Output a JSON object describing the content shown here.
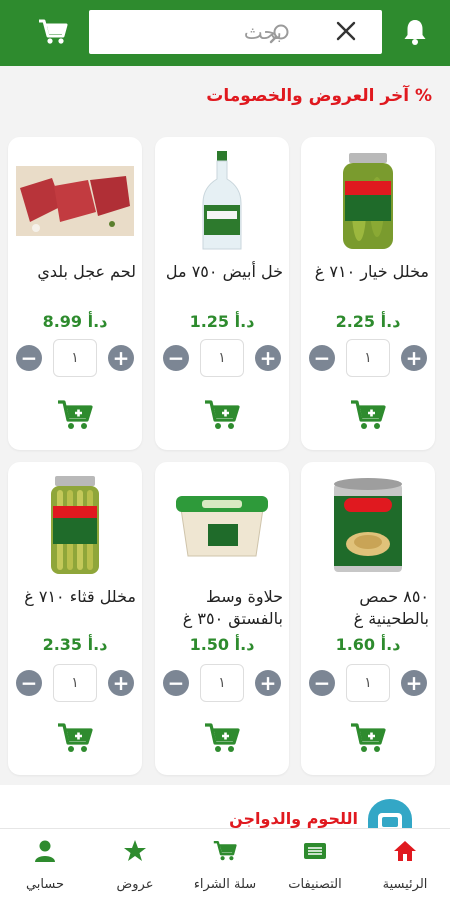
{
  "header": {
    "search_placeholder": "بحث",
    "cart_icon": "cart-icon",
    "bell_icon": "bell-icon"
  },
  "section": {
    "title": "% آخر العروض والخصومات"
  },
  "products": [
    {
      "name": "مخلل خيار ٧١٠ غ",
      "price": "2.25 د.أ",
      "qty": "١"
    },
    {
      "name": "خل أبيض ٧٥٠ مل",
      "price": "1.25 د.أ",
      "qty": "١"
    },
    {
      "name": "لحم عجل بلدي",
      "price": "8.99 د.أ",
      "qty": "١"
    },
    {
      "name": "٨٥٠ حمص بالطحينية غ",
      "price": "1.60 د.أ",
      "qty": "١"
    },
    {
      "name": "حلاوة وسط بالفستق ٣٥٠ غ",
      "price": "1.50 د.أ",
      "qty": "١"
    },
    {
      "name": "مخلل قثاء ٧١٠ غ",
      "price": "2.35 د.أ",
      "qty": "١"
    }
  ],
  "next_section": {
    "title": "اللحوم والدواجن"
  },
  "nav": [
    {
      "label": "الرئيسية",
      "icon": "home-icon"
    },
    {
      "label": "التصنيفات",
      "icon": "categories-icon"
    },
    {
      "label": "سلة الشراء",
      "icon": "cart-icon"
    },
    {
      "label": "عروض",
      "icon": "star-icon"
    },
    {
      "label": "حسابي",
      "icon": "user-icon"
    }
  ],
  "colors": {
    "brand_green": "#2e8b2e",
    "accent_red": "#e0191f",
    "stepper_gray": "#7c8694"
  }
}
